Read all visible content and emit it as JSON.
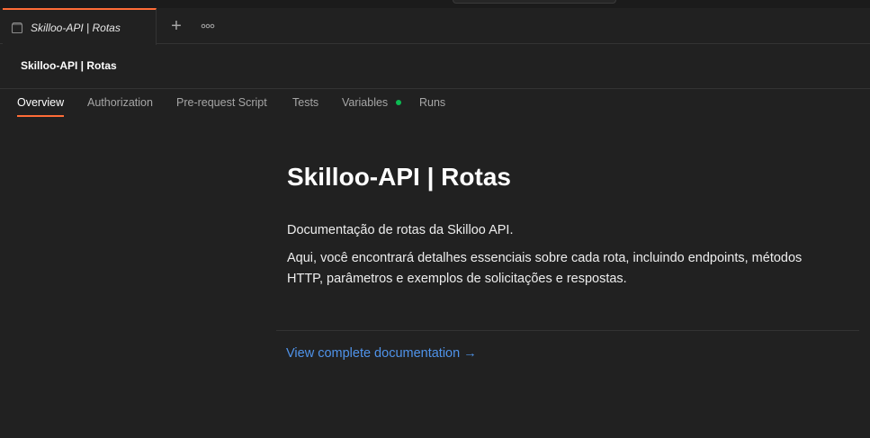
{
  "tab": {
    "label": "Skilloo-API | Rotas",
    "icon": "collection-icon"
  },
  "tabbar": {
    "add_label": "+",
    "more_icon": "more-horizontal-icon"
  },
  "header": {
    "title": "Skilloo-API | Rotas"
  },
  "subtabs": {
    "items": [
      {
        "label": "Overview",
        "active": true
      },
      {
        "label": "Authorization"
      },
      {
        "label": "Pre-request Script"
      },
      {
        "label": "Tests"
      },
      {
        "label": "Variables",
        "indicator": "green-dot-icon"
      },
      {
        "label": "Runs"
      }
    ]
  },
  "doc": {
    "title": "Skilloo-API | Rotas",
    "paragraph1": "Documentação de rotas da Skilloo API.",
    "paragraph2": "Aqui, você encontrará detalhes essenciais sobre cada rota, incluindo endpoints, métodos HTTP, parâmetros e exemplos de solicitações e respostas.",
    "link": "View complete documentation →"
  },
  "colors": {
    "accent": "#ff6c37",
    "link": "#4f93ea",
    "indicator": "#0cbb52",
    "background": "#212121"
  }
}
